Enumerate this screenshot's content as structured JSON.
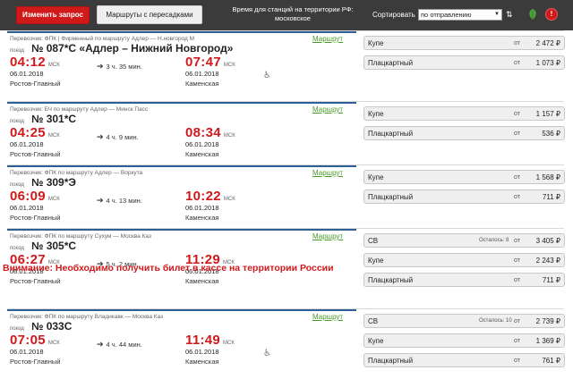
{
  "toolbar": {
    "change_request": "Изменить запрос",
    "transfers": "Маршруты с пересадками",
    "tz_note_line1": "Время для станций на территории РФ:",
    "tz_note_line2": "московское",
    "sort_label": "Сортировать",
    "sort_value": "по отправлению"
  },
  "labels": {
    "poezd": "поезд",
    "route_link": "Маршрут",
    "ot": "от",
    "tz": "МСК",
    "ruble": "₽"
  },
  "warning": "Внимание: Необходимо получить билет в кассе на территории России",
  "trains": [
    {
      "carrier": "Перевозчик: ФПК | Фирменный   по маршруту Адлер — Н.новгород М",
      "number": "№ 087*С «Адлер – Нижний Новгород»",
      "dep_time": "04:12",
      "arr_time": "07:47",
      "duration": "3 ч. 35 мин.",
      "dep_date": "06.01.2018",
      "arr_date": "06.01.2018",
      "dep_station": "Ростов-Главный",
      "arr_station": "Каменская",
      "accessible": true,
      "cars": [
        {
          "name": "Купе",
          "left": "",
          "price": "2 472"
        },
        {
          "name": "Плацкартный",
          "left": "",
          "price": "1 073"
        }
      ]
    },
    {
      "carrier": "Перевозчик: БЧ   по маршруту Адлер — Минск Пасс",
      "number": "№ 301*С",
      "dep_time": "04:25",
      "arr_time": "08:34",
      "duration": "4 ч. 9 мин.",
      "dep_date": "06.01.2018",
      "arr_date": "06.01.2018",
      "dep_station": "Ростов-Главный",
      "arr_station": "Каменская",
      "accessible": false,
      "cars": [
        {
          "name": "Купе",
          "left": "",
          "price": "1 157"
        },
        {
          "name": "Плацкартный",
          "left": "",
          "price": "536"
        }
      ]
    },
    {
      "carrier": "Перевозчик: ФПК   по маршруту Адлер — Воркута",
      "number": "№ 309*Э",
      "dep_time": "06:09",
      "arr_time": "10:22",
      "duration": "4 ч. 13 мин.",
      "dep_date": "06.01.2018",
      "arr_date": "06.01.2018",
      "dep_station": "Ростов-Главный",
      "arr_station": "Каменская",
      "accessible": false,
      "cars": [
        {
          "name": "Купе",
          "left": "",
          "price": "1 568"
        },
        {
          "name": "Плацкартный",
          "left": "",
          "price": "711"
        }
      ]
    },
    {
      "carrier": "Перевозчик: ФПК   по маршруту Сухум — Москва Каз",
      "number": "№ 305*С",
      "dep_time": "06:27",
      "arr_time": "11:29",
      "duration": "5 ч. 2 мин.",
      "dep_date": "06.01.2018",
      "arr_date": "06.01.2018",
      "dep_station": "Ростов-Главный",
      "arr_station": "Каменская",
      "accessible": false,
      "cars": [
        {
          "name": "СВ",
          "left": "Осталось: 8",
          "price": "3 405"
        },
        {
          "name": "Купе",
          "left": "",
          "price": "2 243"
        },
        {
          "name": "Плацкартный",
          "left": "",
          "price": "711"
        }
      ]
    },
    {
      "carrier": "Перевозчик: ФПК   по маршруту Владикавк — Москва Каз",
      "number": "№ 033С",
      "dep_time": "07:05",
      "arr_time": "11:49",
      "duration": "4 ч. 44 мин.",
      "dep_date": "06.01.2018",
      "arr_date": "06.01.2018",
      "dep_station": "Ростов-Главный",
      "arr_station": "Каменская",
      "accessible": true,
      "cars": [
        {
          "name": "СВ",
          "left": "Осталось: 10",
          "price": "2 739"
        },
        {
          "name": "Купе",
          "left": "",
          "price": "1 369"
        },
        {
          "name": "Плацкартный",
          "left": "",
          "price": "761"
        }
      ]
    }
  ]
}
